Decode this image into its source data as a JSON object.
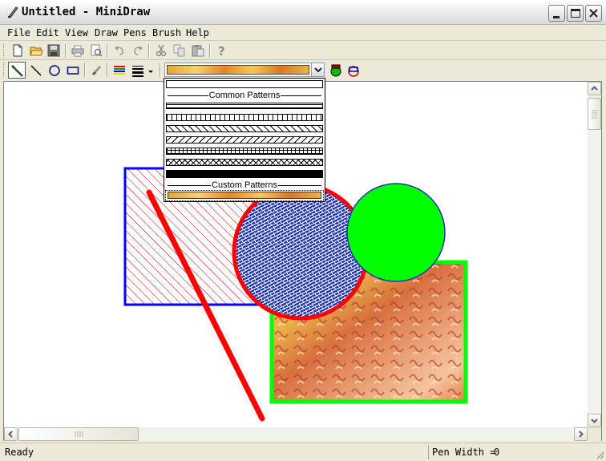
{
  "window": {
    "title": "Untitled - MiniDraw"
  },
  "menu": [
    {
      "label": "File"
    },
    {
      "label": "Edit"
    },
    {
      "label": "View"
    },
    {
      "label": "Draw"
    },
    {
      "label": "Pens"
    },
    {
      "label": "Brush"
    },
    {
      "label": "Help"
    }
  ],
  "toolbar": {
    "standard": [
      "new-icon",
      "open-icon",
      "save-icon",
      "print-icon",
      "print-preview-icon",
      "cut-icon",
      "copy-icon",
      "paste-icon",
      "undo-icon",
      "redo-icon",
      "help-icon"
    ],
    "drawing": [
      "select-icon",
      "line-icon",
      "ellipse-icon",
      "rectangle-icon",
      "eraser-icon",
      "pen-color-icon",
      "line-width-icon",
      "fill-color-icon",
      "bring-front-icon"
    ]
  },
  "pattern_dropdown": {
    "common_label": "Common Patterns",
    "custom_label": "Custom Patterns",
    "common_patterns": [
      "solid-white",
      "horizontal",
      "vertical",
      "forward-diagonal",
      "backward-diagonal",
      "cross",
      "diagonal-cross",
      "solid-black"
    ],
    "custom_patterns": [
      "orange-texture"
    ]
  },
  "status": {
    "ready": "Ready",
    "pen_width_label": "Pen Width =",
    "pen_width_value": "0"
  },
  "colors": {
    "rect_outline": "#0000FF",
    "hatch": "#CC0000",
    "circle_outline": "#FF0000",
    "weave": "#1E32B4",
    "green": "#00FF00",
    "line": "#FF0000"
  }
}
